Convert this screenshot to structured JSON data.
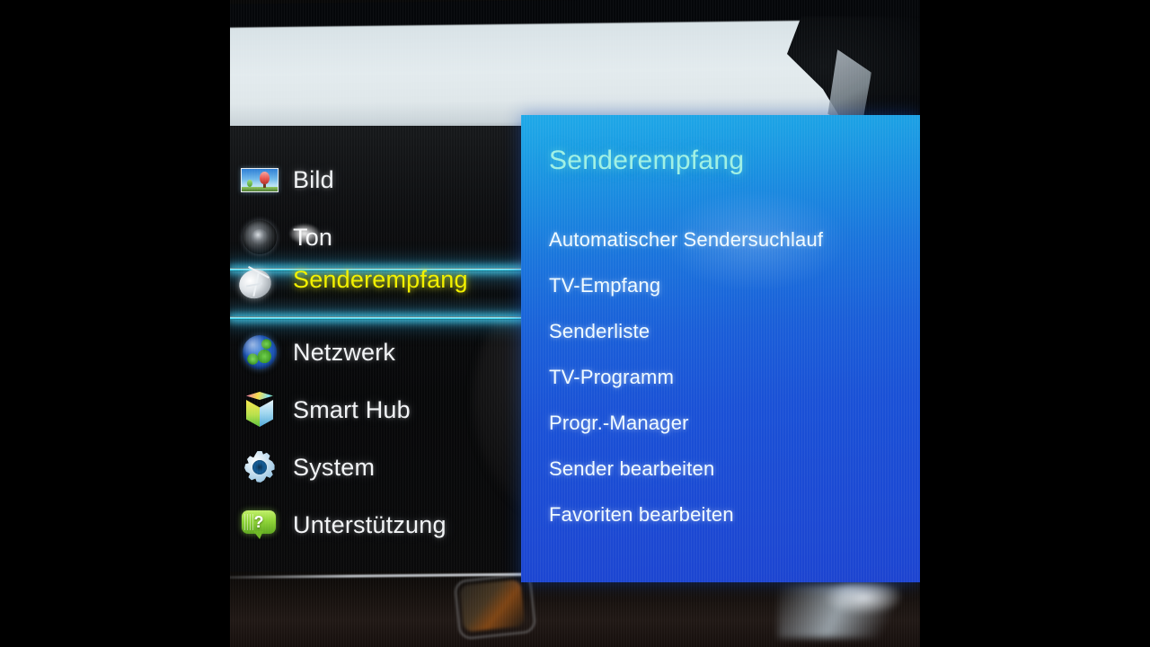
{
  "screen": {
    "device": "smart-tv-settings-menu",
    "language": "de"
  },
  "main_menu": {
    "items": [
      {
        "label": "Bild",
        "icon": "picture-icon",
        "selected": false
      },
      {
        "label": "Ton",
        "icon": "speaker-icon",
        "selected": false
      },
      {
        "label": "Senderempfang",
        "icon": "satellite-dish-icon",
        "selected": true
      },
      {
        "label": "Netzwerk",
        "icon": "globe-icon",
        "selected": false
      },
      {
        "label": "Smart Hub",
        "icon": "cube-icon",
        "selected": false
      },
      {
        "label": "System",
        "icon": "gear-icon",
        "selected": false
      },
      {
        "label": "Unterstützung",
        "icon": "help-bubble-icon",
        "selected": false
      }
    ]
  },
  "sub_panel": {
    "title": "Senderempfang",
    "items": [
      {
        "label": "Automatischer Sendersuchlauf"
      },
      {
        "label": "TV-Empfang"
      },
      {
        "label": "Senderliste"
      },
      {
        "label": "TV-Programm"
      },
      {
        "label": "Progr.-Manager"
      },
      {
        "label": "Sender bearbeiten"
      },
      {
        "label": "Favoriten bearbeiten"
      }
    ]
  },
  "colors": {
    "selected_label": "#f2f000",
    "selection_glow": "#2fd8f7",
    "panel_title": "#9ff0e4",
    "panel_top": "#1fa9e8",
    "panel_bottom": "#1d44d0",
    "menu_label": "#f2f4f6"
  }
}
